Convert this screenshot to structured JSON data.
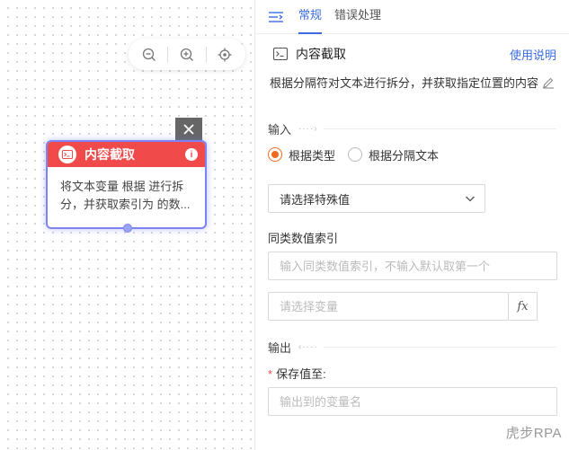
{
  "canvas": {
    "zoom_out_icon": "zoom-out-icon",
    "zoom_in_icon": "zoom-in-icon",
    "locate_icon": "locate-icon"
  },
  "node": {
    "title": "内容截取",
    "body_line1": "将文本变量 根据 进行拆",
    "body_line2": "分，并获取索引为 的数..."
  },
  "panel": {
    "tabs": [
      {
        "label": "常规",
        "active": true
      },
      {
        "label": "错误处理",
        "active": false
      }
    ],
    "title": "内容截取",
    "help_link": "使用说明",
    "description": "根据分隔符对文本进行拆分，并获取指定位置的内容",
    "input_section": "输入",
    "radio_options": [
      {
        "label": "根据类型",
        "checked": true
      },
      {
        "label": "根据分隔文本",
        "checked": false
      }
    ],
    "select": {
      "value": "请选择特殊值"
    },
    "index_label": "同类数值索引",
    "index_placeholder": "输入同类数值索引，不输入默认取第一个",
    "variable_placeholder": "请选择变量",
    "fx_label": "fx",
    "output_section": "输出",
    "save_label": "保存值至:",
    "save_placeholder": "输出到的变量名"
  },
  "watermark": "虎步RPA",
  "colors": {
    "accent": "#3b6de0",
    "node_header": "#f04a4a",
    "radio_checked": "#ee6a1e",
    "node_border": "#7b84f0"
  }
}
